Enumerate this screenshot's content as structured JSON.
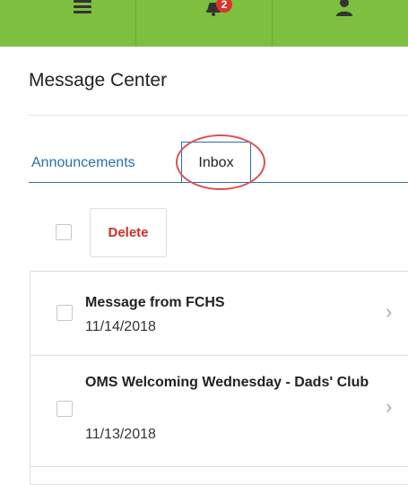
{
  "topbar": {
    "icons": [
      "menu-icon",
      "bell-icon",
      "user-icon"
    ],
    "notification_count": "2",
    "accent_color": "#7dbf3f"
  },
  "page": {
    "title": "Message Center"
  },
  "tabs": [
    {
      "label": "Announcements",
      "active": false
    },
    {
      "label": "Inbox",
      "active": true
    }
  ],
  "toolbar": {
    "delete_label": "Delete"
  },
  "messages": [
    {
      "subject": "Message from FCHS",
      "date": "11/14/2018"
    },
    {
      "subject": "OMS Welcoming Wednesday - Dads' Club",
      "date": "11/13/2018"
    }
  ]
}
